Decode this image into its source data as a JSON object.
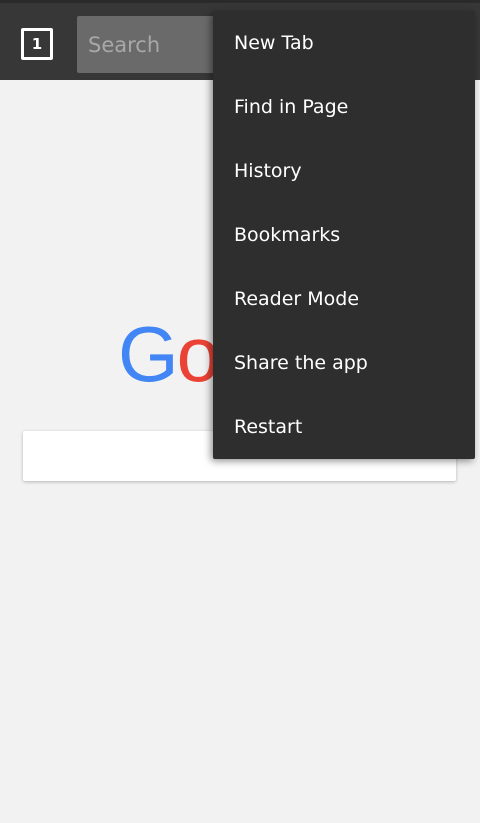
{
  "toolbar": {
    "tab_count": "1",
    "search_placeholder": "Search"
  },
  "page": {
    "logo_letters": [
      "G",
      "o",
      "o",
      "g",
      "l",
      "e"
    ],
    "search_button_label": "Search"
  },
  "menu": {
    "items": [
      {
        "label": "New Tab"
      },
      {
        "label": "Find in Page"
      },
      {
        "label": "History"
      },
      {
        "label": "Bookmarks"
      },
      {
        "label": "Reader Mode"
      },
      {
        "label": "Share the app"
      },
      {
        "label": "Restart"
      }
    ]
  }
}
